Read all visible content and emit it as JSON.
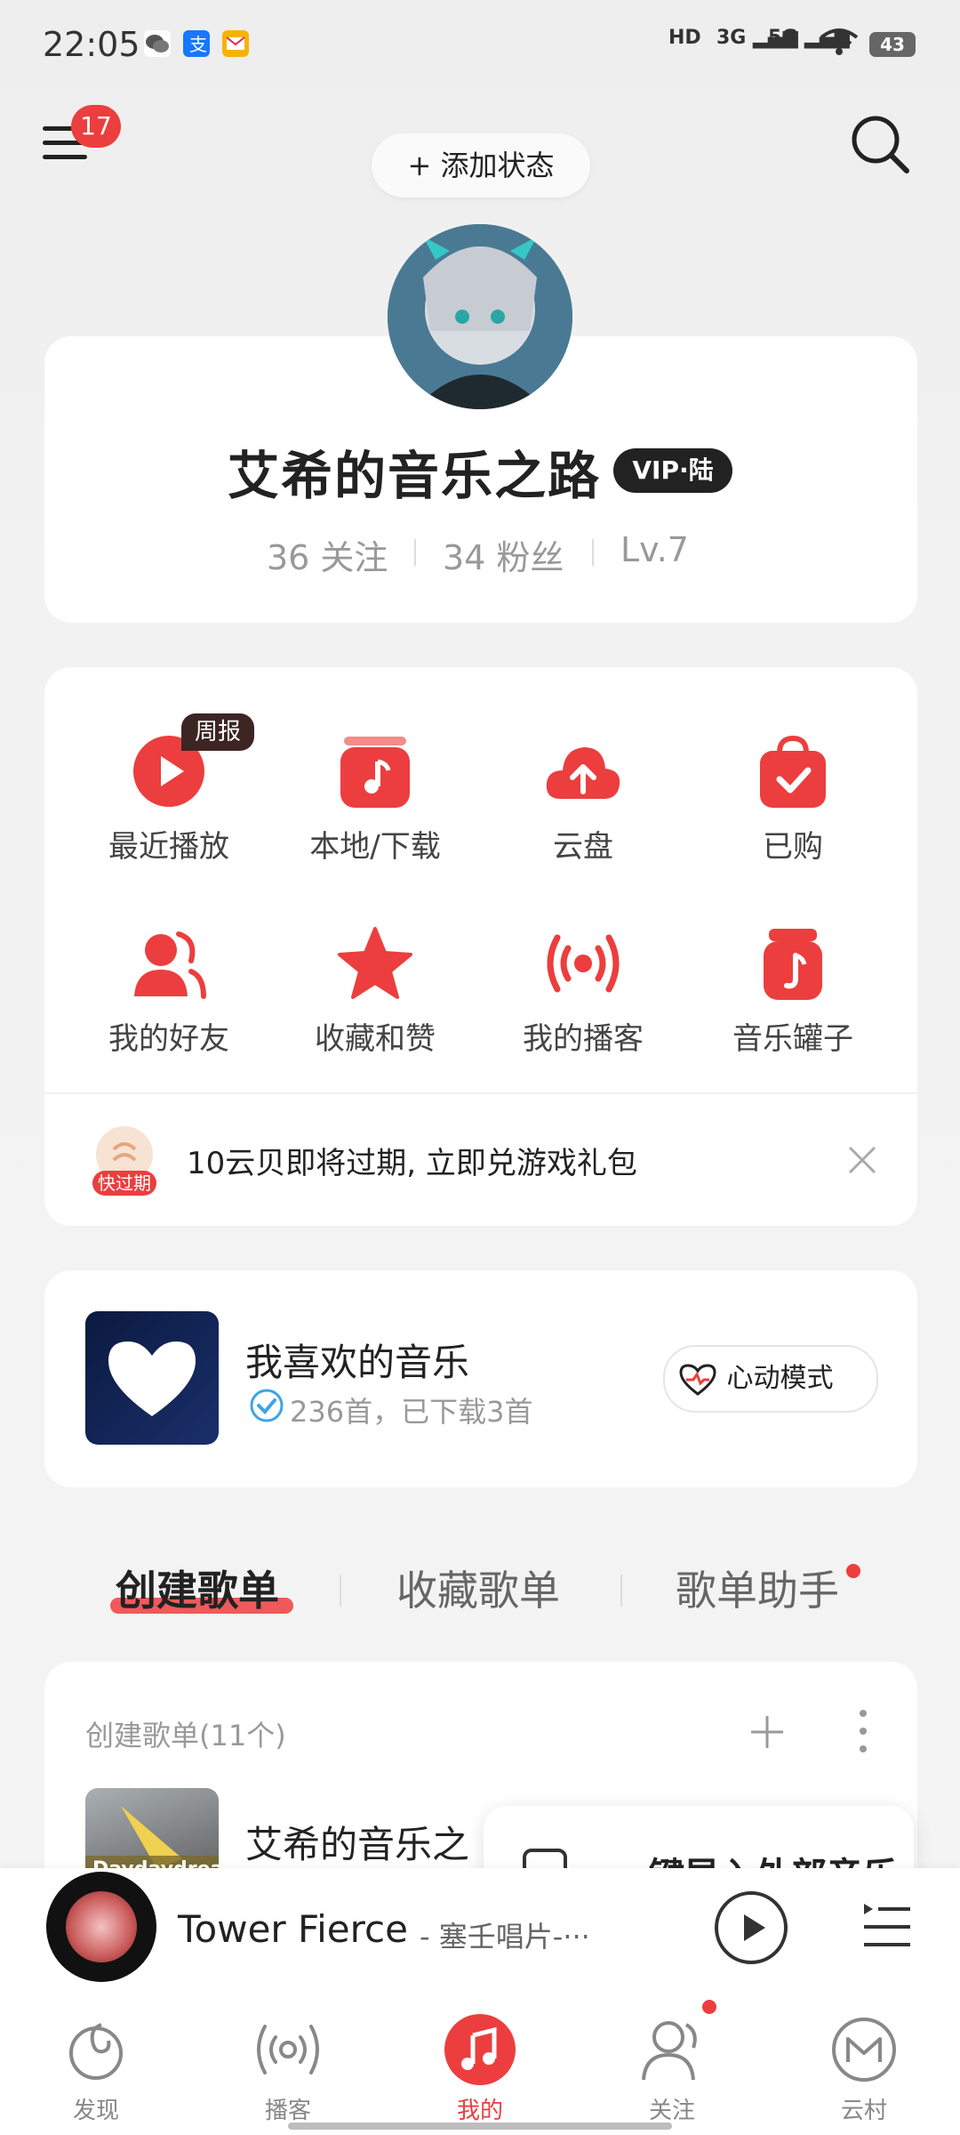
{
  "status_bar": {
    "time": "22:05",
    "hd": "HD",
    "net1": "3G",
    "net2": "5G",
    "battery": "43"
  },
  "header": {
    "notification_count": "17",
    "add_status_label": "+ 添加状态"
  },
  "profile": {
    "username": "艾希的音乐之路",
    "vip_badge": "VIP·陆",
    "stats": {
      "following": "36 关注",
      "followers": "34 粉丝",
      "level": "Lv.7"
    }
  },
  "functions": {
    "weekly_tag": "周报",
    "items": [
      {
        "label": "最近播放",
        "icon": "play-circle-icon"
      },
      {
        "label": "本地/下载",
        "icon": "music-note-icon"
      },
      {
        "label": "云盘",
        "icon": "cloud-upload-icon"
      },
      {
        "label": "已购",
        "icon": "shopping-bag-icon"
      },
      {
        "label": "我的好友",
        "icon": "friends-icon"
      },
      {
        "label": "收藏和赞",
        "icon": "star-icon"
      },
      {
        "label": "我的播客",
        "icon": "podcast-icon"
      },
      {
        "label": "音乐罐子",
        "icon": "music-jar-icon"
      }
    ],
    "notice": {
      "tag": "快过期",
      "text": "10云贝即将过期, 立即兑游戏礼包"
    }
  },
  "liked_music": {
    "title": "我喜欢的音乐",
    "subtitle": "236首，已下载3首",
    "heartbeat_label": "心动模式"
  },
  "tabs": [
    {
      "label": "创建歌单",
      "active": true
    },
    {
      "label": "收藏歌单",
      "active": false
    },
    {
      "label": "歌单助手",
      "active": false
    }
  ],
  "playlists": {
    "section_title": "创建歌单(11个)",
    "first_title": "艾希的音乐之",
    "cover_text": "Daydaydream",
    "popup_text": "一键导入外部音乐"
  },
  "mini_player": {
    "title": "Tower Fierce",
    "artist": " - 塞壬唱片-···"
  },
  "bottom_nav": [
    {
      "label": "发现",
      "icon": "discover-icon"
    },
    {
      "label": "播客",
      "icon": "podcast-icon"
    },
    {
      "label": "我的",
      "icon": "music-note-icon"
    },
    {
      "label": "关注",
      "icon": "follow-icon"
    },
    {
      "label": "云村",
      "icon": "cloud-village-icon"
    }
  ],
  "colors": {
    "accent": "#ec3e3e",
    "background": "#f2f2f2",
    "card": "#ffffff"
  }
}
